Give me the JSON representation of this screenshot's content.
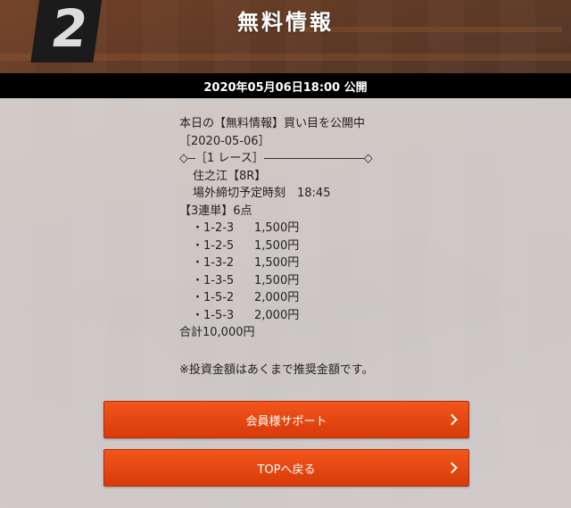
{
  "header": {
    "title": "無料情報",
    "background_sign": "2"
  },
  "publish": {
    "datetime": "2020年05月06日18:00 公開"
  },
  "info": {
    "intro": "本日の【無料情報】買い目を公開中",
    "date": "［2020-05-06］",
    "race_count_label": "［1 レース］",
    "venue": "住之江【8R】",
    "deadline": "場外締切予定時刻　18:45",
    "bet_type": "【3連単】6点",
    "bets": [
      {
        "combo": "・1-2-3",
        "amount": "1,500円"
      },
      {
        "combo": "・1-2-5",
        "amount": "1,500円"
      },
      {
        "combo": "・1-3-2",
        "amount": "1,500円"
      },
      {
        "combo": "・1-3-5",
        "amount": "1,500円"
      },
      {
        "combo": "・1-5-2",
        "amount": "2,000円"
      },
      {
        "combo": "・1-5-3",
        "amount": "2,000円"
      }
    ],
    "total": "合計10,000円",
    "note": "※投資金額はあくまで推奨金額です。"
  },
  "buttons": {
    "support_label": "会員様サポート",
    "top_label": "TOPへ戻る"
  },
  "colors": {
    "button": "#e34812",
    "date_bar": "#000000",
    "panel": "#ebe9e9"
  }
}
